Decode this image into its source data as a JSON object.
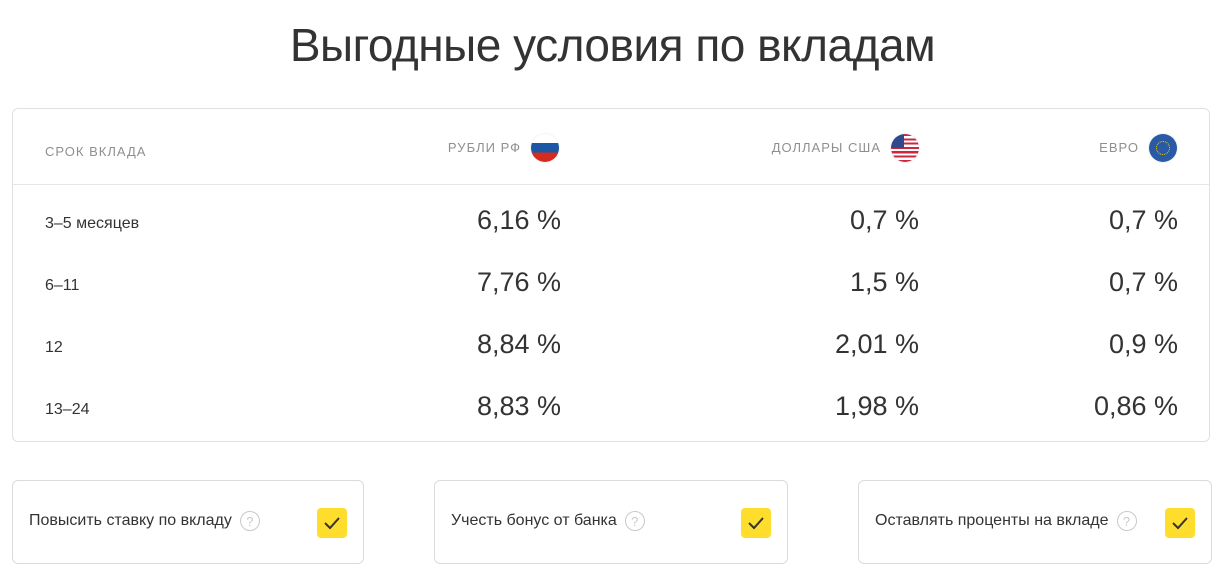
{
  "title": "Выгодные условия по вкладам",
  "table": {
    "headers": {
      "term": "СРОК ВКЛАДА",
      "rub": "РУБЛИ РФ",
      "usd": "ДОЛЛАРЫ США",
      "eur": "ЕВРО"
    },
    "flags": {
      "rub": "russia-flag-icon",
      "usd": "usa-flag-icon",
      "eur": "eu-flag-icon"
    },
    "rows": [
      {
        "term": "3–5 месяцев",
        "rub": "6,16 %",
        "usd": "0,7 %",
        "eur": "0,7 %"
      },
      {
        "term": "6–11",
        "rub": "7,76 %",
        "usd": "1,5 %",
        "eur": "0,7 %"
      },
      {
        "term": "12",
        "rub": "8,84 %",
        "usd": "2,01 %",
        "eur": "0,9 %"
      },
      {
        "term": "13–24",
        "rub": "8,83 %",
        "usd": "1,98 %",
        "eur": "0,86 %"
      }
    ]
  },
  "options": [
    {
      "label": "Повысить ставку по вкладу",
      "help": "?",
      "checked": true
    },
    {
      "label": "Учесть бонус от банка",
      "help": "?",
      "checked": true
    },
    {
      "label": "Оставлять проценты на вкладе",
      "help": "?",
      "checked": true
    }
  ],
  "colors": {
    "accent": "#ffdd2d",
    "border": "#e1e1e1",
    "muted": "#8f8f8f"
  }
}
